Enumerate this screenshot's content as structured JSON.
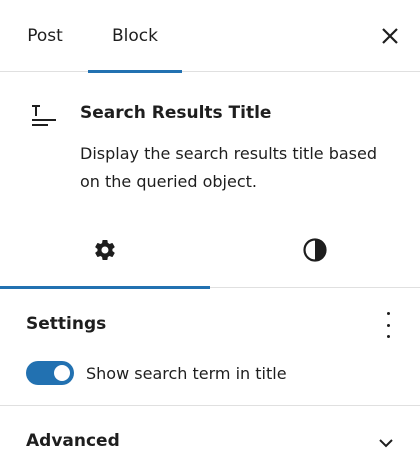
{
  "tabs": {
    "post_label": "Post",
    "block_label": "Block",
    "active": "Block"
  },
  "block": {
    "title": "Search Results Title",
    "description": "Display the search results title based on the queried object.",
    "icon": "title-icon"
  },
  "inspector_tabs": {
    "settings_icon": "gear-icon",
    "styles_icon": "half-circle-contrast-icon",
    "active": "settings"
  },
  "settings": {
    "heading": "Settings",
    "toggle_label": "Show search term in title",
    "toggle_on": true
  },
  "advanced": {
    "title": "Advanced"
  },
  "colors": {
    "accent": "#2271b1",
    "text": "#1e1e1e",
    "divider": "#e0e0e0"
  }
}
